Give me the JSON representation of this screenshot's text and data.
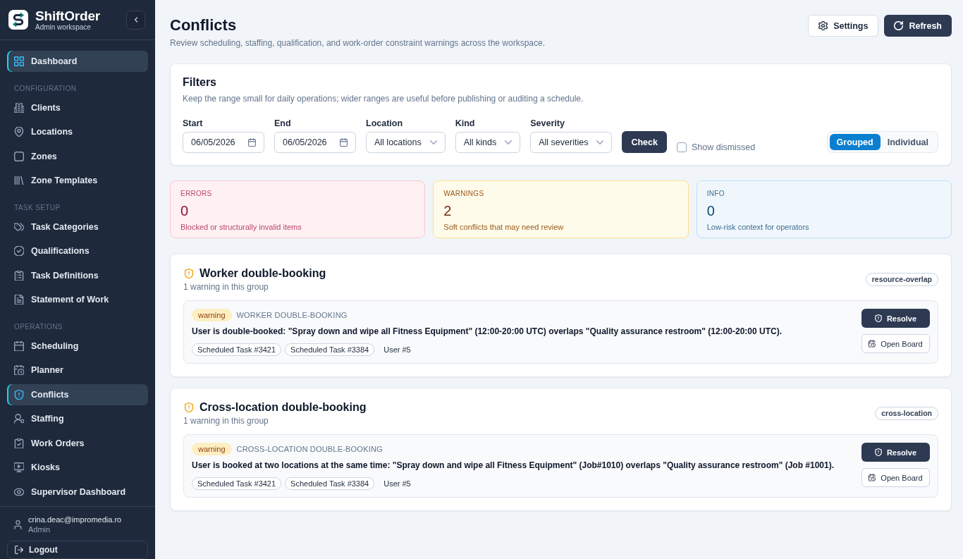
{
  "sidebar": {
    "brand": {
      "name": "ShiftOrder",
      "subtitle": "Admin workspace"
    },
    "sections": [
      {
        "items": [
          {
            "label": "Dashboard",
            "selected": true
          }
        ]
      },
      {
        "heading": "CONFIGURATION",
        "items": [
          {
            "label": "Clients",
            "selected": false
          },
          {
            "label": "Locations",
            "selected": false
          },
          {
            "label": "Zones",
            "selected": false
          },
          {
            "label": "Zone Templates",
            "selected": false
          }
        ]
      },
      {
        "heading": "TASK SETUP",
        "items": [
          {
            "label": "Task Categories",
            "selected": false
          },
          {
            "label": "Qualifications",
            "selected": false
          },
          {
            "label": "Task Definitions",
            "selected": false
          },
          {
            "label": "Statement of Work",
            "selected": false
          }
        ]
      },
      {
        "heading": "OPERATIONS",
        "items": [
          {
            "label": "Scheduling",
            "selected": false
          },
          {
            "label": "Planner",
            "selected": false
          },
          {
            "label": "Conflicts",
            "selected": true
          },
          {
            "label": "Staffing",
            "selected": false
          },
          {
            "label": "Work Orders",
            "selected": false
          },
          {
            "label": "Kiosks",
            "selected": false
          },
          {
            "label": "Supervisor Dashboard",
            "selected": false
          }
        ]
      }
    ],
    "user": {
      "email": "crina.deac@impromedia.ro",
      "role": "Admin"
    },
    "logout": "Logout"
  },
  "header": {
    "title": "Conflicts",
    "subtitle": "Review scheduling, staffing, qualification, and work-order constraint warnings across the workspace.",
    "buttons": {
      "settings": "Settings",
      "refresh": "Refresh"
    }
  },
  "filters": {
    "title": "Filters",
    "description": "Keep the range small for daily operations; wider ranges are useful before publishing or auditing a schedule.",
    "fields": [
      {
        "label": "Start",
        "kind": "date",
        "value": "06/05/2026"
      },
      {
        "label": "End",
        "kind": "date",
        "value": "06/05/2026"
      },
      {
        "label": "Location",
        "kind": "select",
        "value": "All locations"
      },
      {
        "label": "Kind",
        "kind": "select",
        "value": "All kinds"
      },
      {
        "label": "Severity",
        "kind": "select",
        "value": "All severities"
      }
    ],
    "check_button": "Check",
    "show_dismissed": {
      "label": "Show dismissed",
      "checked": false
    },
    "view_modes": [
      {
        "label": "Grouped",
        "selected": true
      },
      {
        "label": "Individual",
        "selected": false
      }
    ]
  },
  "stats": [
    {
      "kind": "error",
      "label": "ERRORS",
      "count": "0",
      "description": "Blocked or structurally invalid items"
    },
    {
      "kind": "warning",
      "label": "WARNINGS",
      "count": "2",
      "description": "Soft conflicts that may need review"
    },
    {
      "kind": "info",
      "label": "INFO",
      "count": "0",
      "description": "Low-risk context for operators"
    }
  ],
  "groups": [
    {
      "title": "Worker double-booking",
      "subtitle": "1 warning in this group",
      "tag": "resource-overlap",
      "items": [
        {
          "badge": {
            "label": "warning",
            "kind": "warning"
          },
          "type": "WORKER DOUBLE-BOOKING",
          "message": "User is double-booked: \"Spray down and wipe all Fitness Equipment\" (12:00-20:00 UTC) overlaps \"Quality assurance restroom\" (12:00-20:00 UTC).",
          "refs": [
            {
              "label": "Scheduled Task #3421",
              "outlined": true
            },
            {
              "label": "Scheduled Task #3384",
              "outlined": true
            },
            {
              "label": "User #5",
              "outlined": false
            }
          ],
          "actions": {
            "resolve": "Resolve",
            "open_board": "Open Board"
          }
        }
      ]
    },
    {
      "title": "Cross-location double-booking",
      "subtitle": "1 warning in this group",
      "tag": "cross-location",
      "items": [
        {
          "badge": {
            "label": "warning",
            "kind": "warning"
          },
          "type": "CROSS-LOCATION DOUBLE-BOOKING",
          "message": "User is booked at two locations at the same time: \"Spray down and wipe all Fitness Equipment\" (Job#1010) overlaps \"Quality assurance restroom\" (Job #1001).",
          "refs": [
            {
              "label": "Scheduled Task #3421",
              "outlined": true
            },
            {
              "label": "Scheduled Task #3384",
              "outlined": true
            },
            {
              "label": "User #5",
              "outlined": false
            }
          ],
          "actions": {
            "resolve": "Resolve",
            "open_board": "Open Board"
          }
        }
      ]
    }
  ]
}
